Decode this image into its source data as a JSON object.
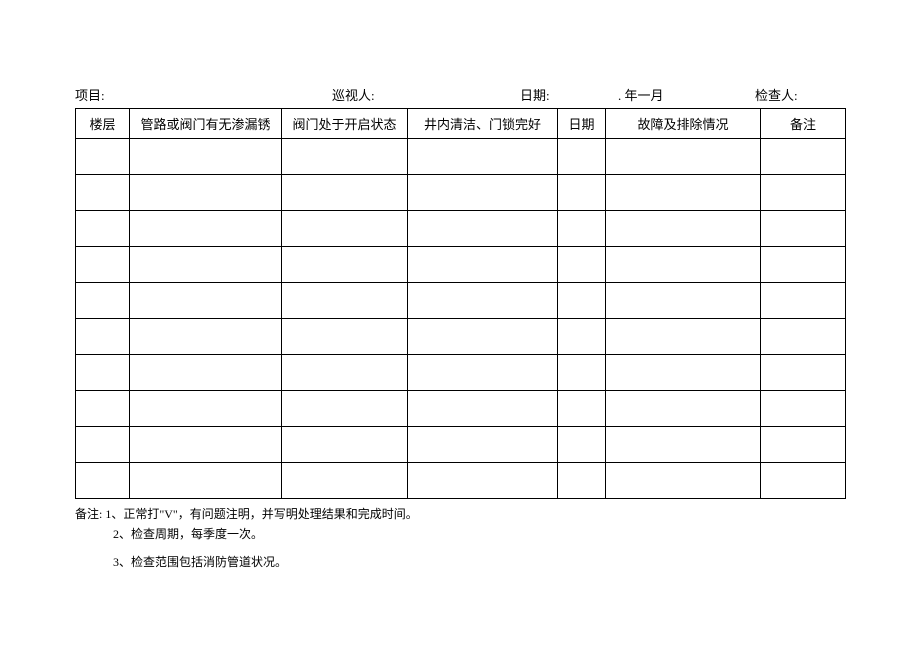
{
  "header": {
    "project_label": "项目:",
    "inspector_label": "巡视人:",
    "date_label": "日期:",
    "date_value": ". 年一月",
    "checker_label": "检查人:"
  },
  "table": {
    "columns": [
      "楼层",
      "管路或阀门有无渗漏锈",
      "阀门处于开启状态",
      "井内清洁、门锁完好",
      "日期",
      "故障及排除情况",
      "备注"
    ],
    "row_count": 10
  },
  "notes": {
    "prefix": "备注:",
    "items": [
      "1、正常打\"V\"，有问题注明，并写明处理结果和完成时间。",
      "2、检查周期，每季度一次。",
      "3、检查范围包括消防管道状况。"
    ]
  }
}
